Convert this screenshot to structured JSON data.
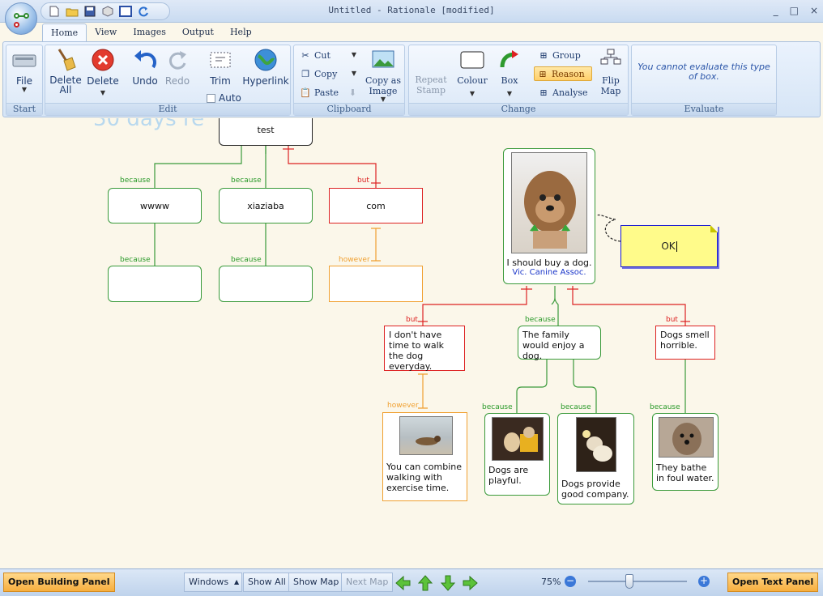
{
  "window": {
    "title": "Untitled - Rationale [modified]",
    "controls": [
      "_",
      "□",
      "×"
    ]
  },
  "ribbon": {
    "tabs": [
      "Home",
      "View",
      "Images",
      "Output",
      "Help"
    ],
    "start": {
      "file": "File",
      "label": "Start"
    },
    "edit": {
      "delete_all": "Delete All",
      "delete": "Delete",
      "undo": "Undo",
      "redo": "Redo",
      "trim": "Trim",
      "auto": "Auto",
      "hyperlink": "Hyperlink",
      "label": "Edit"
    },
    "clipboard": {
      "cut": "Cut",
      "copy": "Copy",
      "paste": "Paste",
      "copy_as_image": "Copy as Image",
      "label": "Clipboard"
    },
    "change": {
      "repeat_stamp": "Repeat Stamp",
      "colour": "Colour",
      "box": "Box",
      "group": "Group",
      "reason": "Reason",
      "analyse": "Analyse",
      "flip_map": "Flip Map",
      "label": "Change"
    },
    "evaluate": {
      "message": "You cannot evaluate this type of box.",
      "label": "Evaluate"
    }
  },
  "canvas": {
    "watermark": "30 days re",
    "left_map": {
      "root": "test",
      "boxes": [
        {
          "label": "because",
          "text": "wwww"
        },
        {
          "label": "because",
          "text": "xiaziaba"
        },
        {
          "label": "but",
          "text": "com"
        }
      ],
      "sub_boxes": [
        {
          "label": "because",
          "text": ""
        },
        {
          "label": "because",
          "text": ""
        },
        {
          "label": "however",
          "text": ""
        }
      ]
    },
    "right_map": {
      "root_text": "I should buy a dog.",
      "root_source": "Vic. Canine Assoc.",
      "note": "OK",
      "premises": [
        {
          "label": "but",
          "text": "I don't have time to walk the dog everyday."
        },
        {
          "label": "because",
          "text": "The family would enjoy a dog."
        },
        {
          "label": "but",
          "text": "Dogs smell horrible."
        }
      ],
      "sub_premises": [
        {
          "label": "however",
          "text": "You can combine walking with exercise time."
        },
        {
          "label": "because",
          "text": "Dogs are playful."
        },
        {
          "label": "because",
          "text": "Dogs provide good company."
        },
        {
          "label": "because",
          "text": "They bathe in foul water."
        }
      ]
    }
  },
  "statusbar": {
    "open_building_panel": "Open Building Panel",
    "windows": "Windows",
    "show_all": "Show All",
    "show_map": "Show Map",
    "next_map": "Next Map",
    "zoom": "75%",
    "zoom_level": 0.42,
    "open_text_panel": "Open Text Panel"
  },
  "colors": {
    "support": "#3a9a3a",
    "objection": "#dd2222",
    "rebuttal": "#f0a030",
    "accent": "#f7ae3e"
  }
}
